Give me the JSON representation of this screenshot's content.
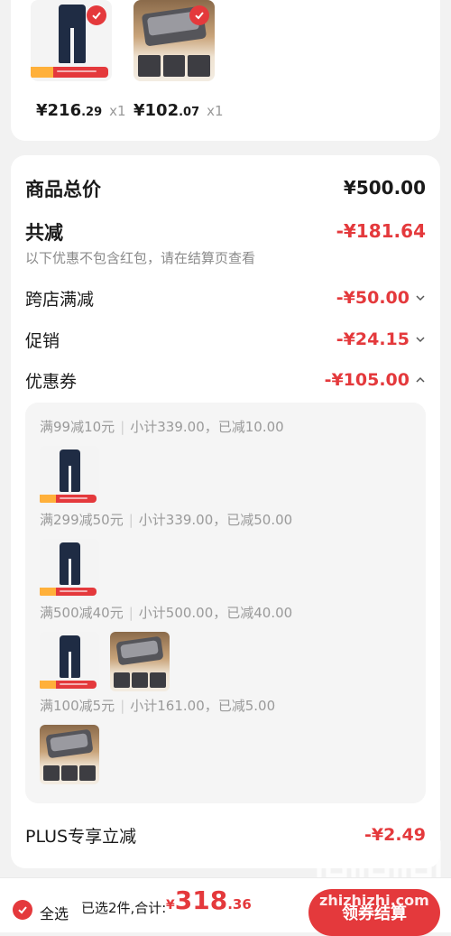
{
  "top_products": [
    {
      "icon": "pants-product-image",
      "price_main": "¥216",
      "price_decimal": ".29",
      "qty": "x1"
    },
    {
      "icon": "gas-stove-product-image",
      "price_main": "¥102",
      "price_decimal": ".07",
      "qty": "x1"
    }
  ],
  "summary": {
    "total_label": "商品总价",
    "total_value": "¥500.00",
    "discount_label": "共减",
    "discount_value": "-¥181.64",
    "discount_hint": "以下优惠不包含红包，请在结算页查看",
    "cross_store_label": "跨店满减",
    "cross_store_value": "-¥50.00",
    "promotion_label": "促销",
    "promotion_value": "-¥24.15",
    "coupon_label": "优惠券",
    "coupon_value": "-¥105.00",
    "plus_label": "PLUS专享立减",
    "plus_value": "-¥2.49"
  },
  "coupons": [
    {
      "rule": "满99减10元",
      "detail": "小计339.00，已减10.00",
      "items": [
        "pants"
      ]
    },
    {
      "rule": "满299减50元",
      "detail": "小计339.00，已减50.00",
      "items": [
        "pants"
      ]
    },
    {
      "rule": "满500减40元",
      "detail": "小计500.00，已减40.00",
      "items": [
        "pants",
        "stove"
      ]
    },
    {
      "rule": "满100减5元",
      "detail": "小计161.00，已减5.00",
      "items": [
        "stove"
      ]
    }
  ],
  "bottom_bar": {
    "select_all": "全选",
    "selected_info": "已选2件,合计:",
    "currency": "¥",
    "total_int": "318",
    "total_dec": ".36",
    "checkout": "领券结算"
  },
  "watermark": "zhizhizhi.com",
  "colors": {
    "accent": "#e4393c",
    "background": "#f2f2f2"
  }
}
